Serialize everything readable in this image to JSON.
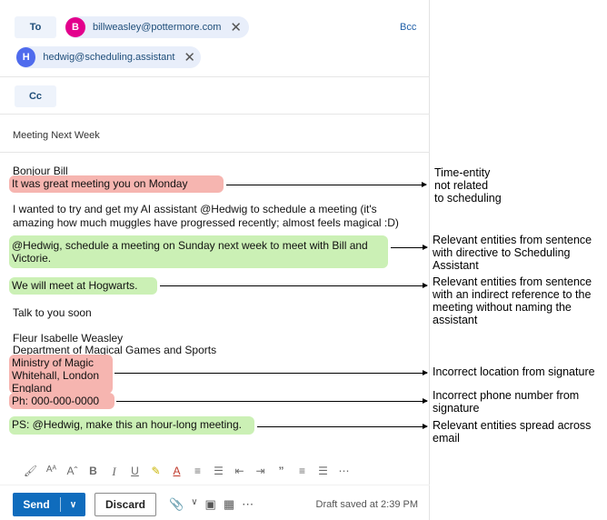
{
  "compose": {
    "to_label": "To",
    "bcc_label": "Bcc",
    "cc_label": "Cc",
    "recipients": [
      {
        "initial": "B",
        "email": "billweasley@pottermore.com",
        "color": "#e3008c"
      },
      {
        "initial": "H",
        "email": "hedwig@scheduling.assistant",
        "color": "#4f6bed"
      }
    ],
    "remove_symbol": "✕",
    "subject": "Meeting Next Week"
  },
  "body": {
    "greeting": "Bonjour Bill",
    "line_monday": "It was great meeting you on Monday",
    "para1_line1": "I wanted to try and get my AI assistant @Hedwig to schedule a meeting (it's",
    "para1_line2": "amazing how much muggles have progressed recently; almost feels magical :D)",
    "directive_line1": "@Hedwig, schedule a meeting on Sunday next week to meet with Bill and",
    "directive_line2": "Victorie.",
    "hogwarts": "We will meet at Hogwarts.",
    "talk_soon": "Talk to you soon",
    "sig_name": "Fleur Isabelle Weasley",
    "sig_dept": "Department of Magical Games and Sports",
    "sig_loc1": "Ministry of Magic",
    "sig_loc2": "Whitehall, London",
    "sig_loc3": "England",
    "sig_phone": "Ph: 000-000-0000",
    "ps": "PS: @Hedwig, make this an hour-long meeting."
  },
  "highlight_colors": {
    "incorrect": "#f6b5b0",
    "relevant": "#cbf0b5"
  },
  "annotations": {
    "time_entity": [
      "Time-entity",
      "not related",
      "to scheduling"
    ],
    "directive": [
      "Relevant entities from sentence",
      "with directive to Scheduling",
      "Assistant"
    ],
    "indirect": [
      "Relevant entities from sentence",
      "with an indirect reference to the",
      "meeting without naming the",
      "assistant"
    ],
    "location": [
      "Incorrect location from signature"
    ],
    "phone": [
      "Incorrect phone number from",
      "signature"
    ],
    "spread": [
      "Relevant entities spread across",
      "email"
    ]
  },
  "toolbar": {
    "icons": [
      "format-painter-icon",
      "font-size-icon",
      "font-grow-icon",
      "bold-icon",
      "italic-icon",
      "underline-icon",
      "highlight-icon",
      "font-color-icon",
      "bullets-icon",
      "numbering-icon",
      "outdent-icon",
      "indent-icon",
      "quote-icon",
      "align-left-icon",
      "align-center-icon",
      "more-icon"
    ],
    "send_label": "Send",
    "discard_label": "Discard",
    "draft_status": "Draft saved at 2:39 PM"
  }
}
